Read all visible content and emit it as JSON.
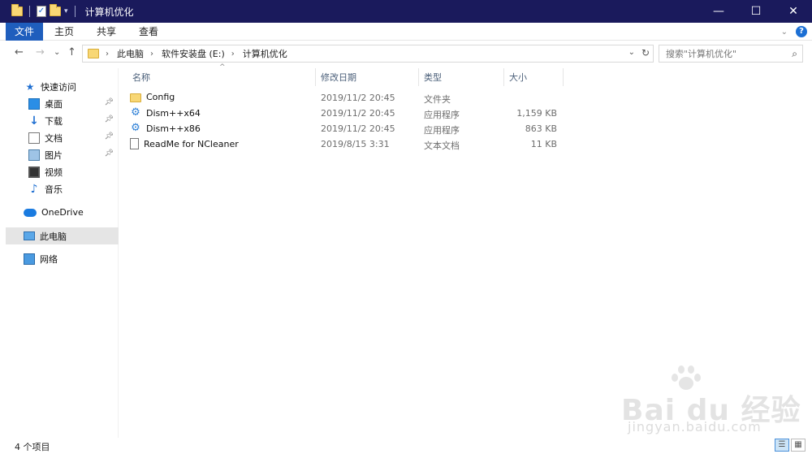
{
  "window": {
    "title": "计算机优化",
    "controls": {
      "minimize": "—",
      "maximize": "☐",
      "close": "✕"
    }
  },
  "quick_access_toolbar": {
    "icons": [
      "folder-icon",
      "properties-icon",
      "new-folder-icon",
      "customize-dropdown-icon"
    ]
  },
  "ribbon": {
    "tabs": [
      {
        "label": "文件",
        "active": true
      },
      {
        "label": "主页"
      },
      {
        "label": "共享"
      },
      {
        "label": "查看"
      }
    ],
    "help": "?"
  },
  "navigation": {
    "back": "←",
    "forward": "→",
    "recent": "⌄",
    "up": "↑",
    "breadcrumb": [
      "此电脑",
      "软件安装盘 (E:)",
      "计算机优化"
    ],
    "search_placeholder": "搜索\"计算机优化\""
  },
  "sidebar": {
    "items": [
      {
        "label": "快速访问",
        "icon": "star-icon",
        "pinned": false
      },
      {
        "label": "桌面",
        "icon": "desktop-icon",
        "pinned": true
      },
      {
        "label": "下载",
        "icon": "download-icon",
        "pinned": true
      },
      {
        "label": "文档",
        "icon": "document-icon",
        "pinned": true
      },
      {
        "label": "图片",
        "icon": "pictures-icon",
        "pinned": true
      },
      {
        "label": "视频",
        "icon": "video-icon",
        "pinned": false
      },
      {
        "label": "音乐",
        "icon": "music-icon",
        "pinned": false
      },
      {
        "label": "OneDrive",
        "icon": "cloud-icon",
        "pinned": false
      },
      {
        "label": "此电脑",
        "icon": "computer-icon",
        "selected": true
      },
      {
        "label": "网络",
        "icon": "network-icon",
        "pinned": false
      }
    ]
  },
  "file_list": {
    "columns": [
      "名称",
      "修改日期",
      "类型",
      "大小"
    ],
    "sorted_by": "名称",
    "rows": [
      {
        "name": "Config",
        "modified": "2019/11/2 20:45",
        "type": "文件夹",
        "size": "",
        "icon": "folder-icon"
      },
      {
        "name": "Dism++x64",
        "modified": "2019/11/2 20:45",
        "type": "应用程序",
        "size": "1,159 KB",
        "icon": "app-icon"
      },
      {
        "name": "Dism++x86",
        "modified": "2019/11/2 20:45",
        "type": "应用程序",
        "size": "863 KB",
        "icon": "app-icon"
      },
      {
        "name": "ReadMe for NCleaner",
        "modified": "2019/8/15 3:31",
        "type": "文本文档",
        "size": "11 KB",
        "icon": "text-file-icon"
      }
    ]
  },
  "status_bar": {
    "item_count": "4 个项目",
    "view_modes": [
      "details-view",
      "large-icons-view"
    ]
  },
  "watermark": {
    "logo": "Bai du 经验",
    "url": "jingyan.baidu.com"
  }
}
